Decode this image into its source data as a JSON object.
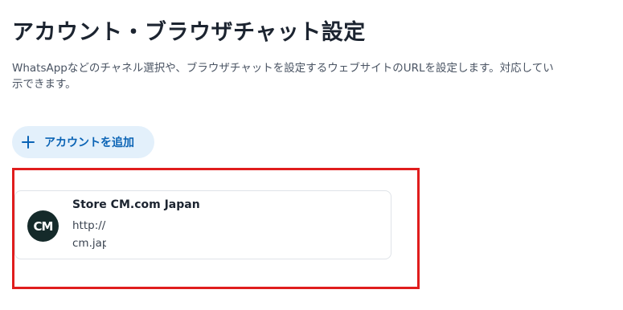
{
  "page": {
    "title": "アカウント・ブラウザチャット設定",
    "description_line1": "WhatsAppなどのチャネル選択や、ブラウザチャットを設定するウェブサイトのURLを設定します。対応してい",
    "description_line2": "示できます。"
  },
  "add_account_button": {
    "label": "アカウントを追加",
    "icon": "plus-icon"
  },
  "account_card": {
    "name": "Store CM.com Japan",
    "url_line1": "http://",
    "url_line2": "cm.jap",
    "logo_text": "CM"
  },
  "colors": {
    "accent": "#0a63b5",
    "button_bg": "#e3f0fb",
    "highlight_border": "#e01d1d",
    "logo_bg": "#152a2a"
  }
}
